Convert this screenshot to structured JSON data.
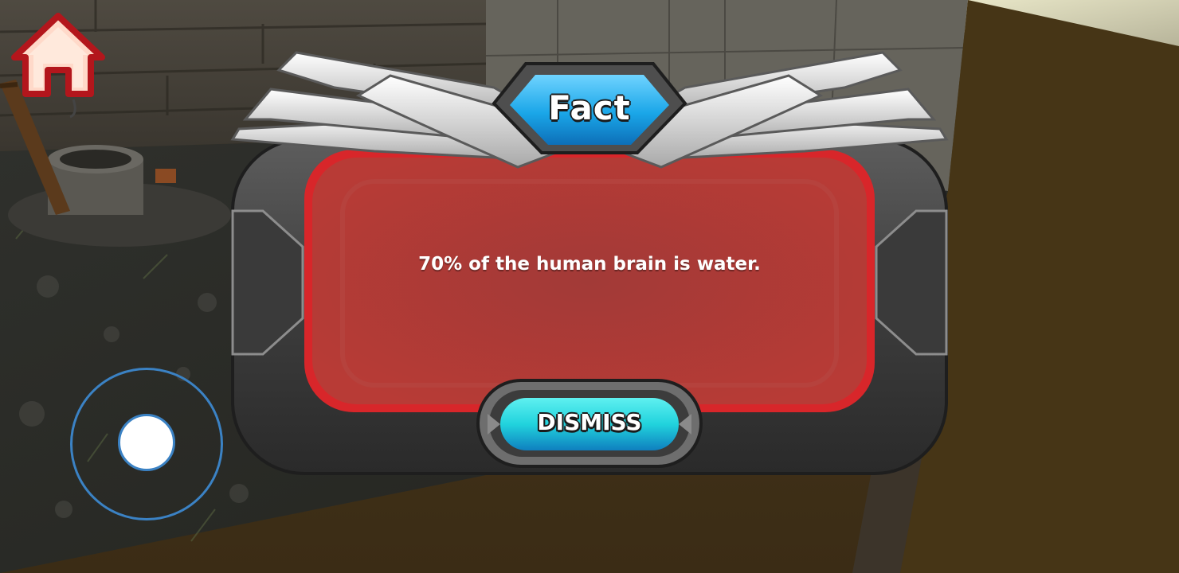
{
  "hud": {
    "home_icon": "home-icon",
    "joystick_icon": "virtual-joystick"
  },
  "dialog": {
    "title": "Fact",
    "message": "70% of the human brain is water.",
    "dismiss_label": "DISMISS"
  },
  "colors": {
    "panel_red": "#a23a37",
    "panel_rim": "#d8262a",
    "frame_gray": "#4a4a4a",
    "title_blue": "#1aa6e8",
    "button_cyan": "#21d3dd",
    "home_red": "#b3161c",
    "joystick_blue": "#3b82c4"
  }
}
